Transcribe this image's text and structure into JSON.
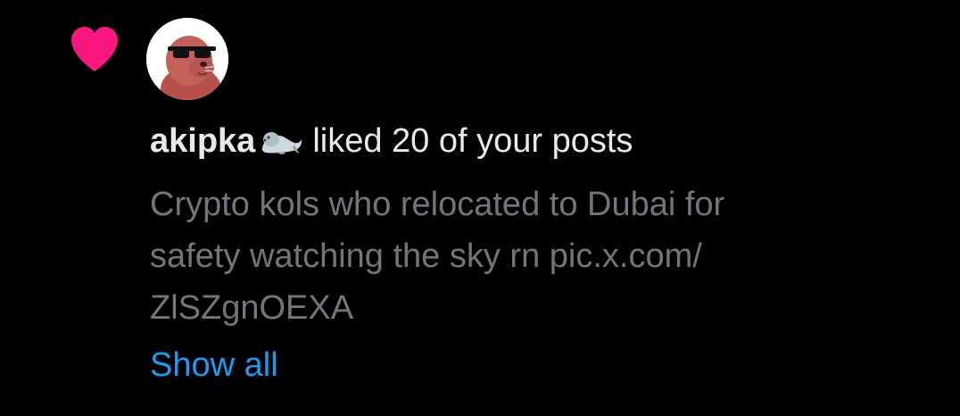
{
  "notification": {
    "type_icon": "heart-icon",
    "type_color": "#f91880",
    "avatar_icon": "sunglasses-seal-avatar",
    "username": "akipka",
    "username_emoji": "seal-icon",
    "action_text": "liked 20 of your posts",
    "post_lines": [
      "Crypto kols who relocated to Dubai for",
      "safety watching the sky rn pic.x.com/",
      "ZlSZgnOEXA"
    ],
    "show_all_label": "Show all"
  },
  "colors": {
    "background": "#000000",
    "primary_text": "#e7e9ea",
    "secondary_text": "#71767b",
    "link": "#1d9bf0",
    "like": "#f91880"
  }
}
